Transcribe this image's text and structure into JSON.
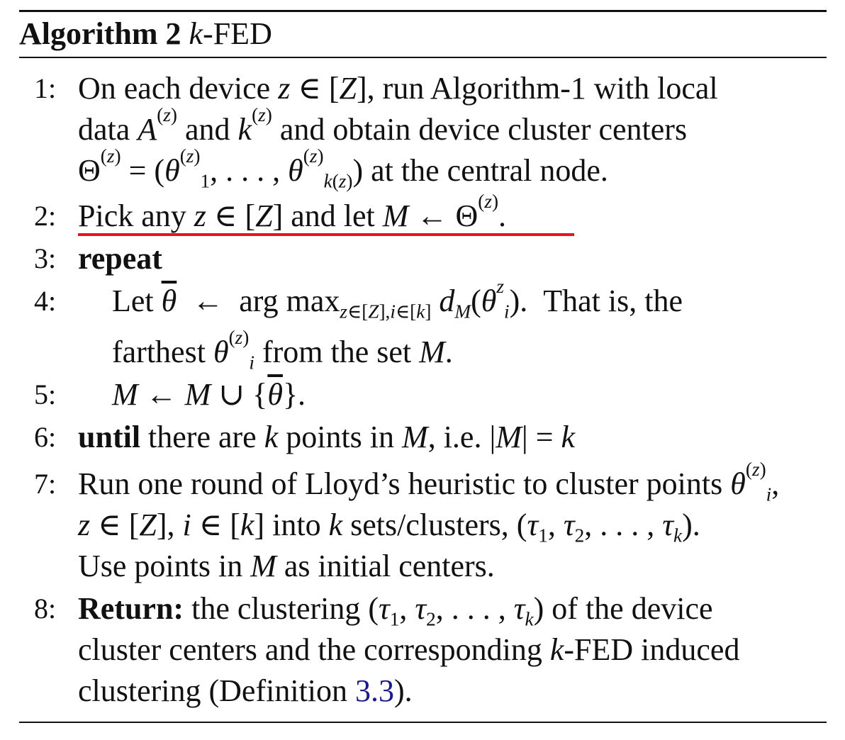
{
  "algorithm": {
    "label": "Algorithm 2",
    "name_var": "k",
    "name_rest": "-FED"
  },
  "steps": [
    {
      "num": "1:"
    },
    {
      "num": "2:"
    },
    {
      "num": "3:"
    },
    {
      "num": "4:"
    },
    {
      "num": "5:"
    },
    {
      "num": "6:"
    },
    {
      "num": "7:"
    },
    {
      "num": "8:"
    }
  ],
  "keywords": {
    "repeat": "repeat",
    "until": "until",
    "return": "Return:"
  },
  "reference": {
    "definition_number": "3.3"
  },
  "annotation": {
    "underline_color": "#e8141c"
  }
}
